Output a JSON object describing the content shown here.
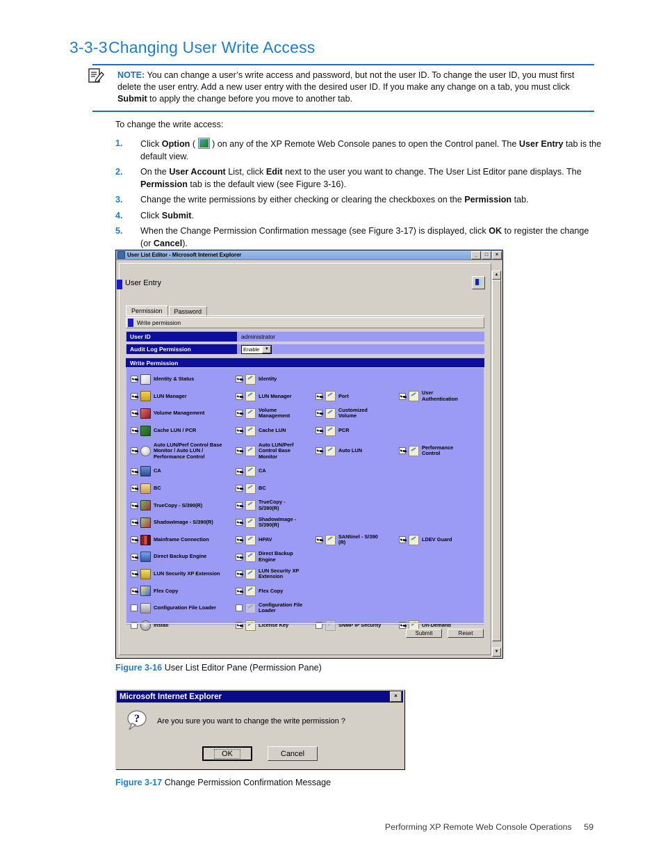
{
  "heading": {
    "number": "3-3-3",
    "title": "Changing User Write Access"
  },
  "note": {
    "label": "NOTE:",
    "text": "You can change a user’s write access and password, but not the user ID. To change the user ID, you must first delete the user entry. Add a new user entry with the desired user ID. If you make any change on a tab, you must click Submit to apply the change before you move to another tab."
  },
  "intro": "To change the write access:",
  "steps": [
    {
      "n": "1.",
      "html": "Click <b>Option</b> ( <i class=\"optglyph\" data-name=\"option-icon\"></i> ) on any of the XP Remote Web Console panes to open the Control panel. The <b>User Entry</b> tab is the default view."
    },
    {
      "n": "2.",
      "html": "On the <b>User Account</b> List, click <b>Edit</b> next to the user you want to change. The User List Editor pane displays. The <b>Permission</b> tab is the default view (see Figure 3-16)."
    },
    {
      "n": "3.",
      "html": "Change the write permissions by either checking or clearing the checkboxes on the <b>Permission</b> tab."
    },
    {
      "n": "4.",
      "html": "Click <b>Submit</b>."
    },
    {
      "n": "5.",
      "html": "When the Change Permission Confirmation message (see Figure 3-17) is displayed, click <b>OK</b> to register the change (or <b>Cancel</b>)."
    }
  ],
  "window": {
    "title": "User List Editor - Microsoft Internet Explorer",
    "min_label": "_",
    "max_label": "□",
    "close_label": "×",
    "pane_heading": "User Entry",
    "tabs": [
      {
        "label": "Permission",
        "selected": true
      },
      {
        "label": "Password",
        "selected": false
      }
    ],
    "write_permission_subtitle": "Write permission",
    "fields": [
      {
        "label": "User ID",
        "value": "administrator"
      },
      {
        "label": "Audit Log Permission",
        "value": "Enable",
        "type": "select"
      }
    ],
    "section_band": "Write Permission",
    "permission_rows": [
      {
        "c1": {
          "label": "Identity & Status",
          "checked": true,
          "icon": "i1"
        },
        "c2": {
          "label": "Identity",
          "checked": true
        },
        "c3": null,
        "c4": null
      },
      {
        "c1": {
          "label": "LUN Manager",
          "checked": true,
          "icon": "i2"
        },
        "c2": {
          "label": "LUN Manager",
          "checked": true
        },
        "c3": {
          "label": "Port",
          "checked": true
        },
        "c4": {
          "label": "User\nAuthentication",
          "checked": true
        }
      },
      {
        "c1": {
          "label": "Volume Management",
          "checked": true,
          "icon": "i3"
        },
        "c2": {
          "label": "Volume\nManagement",
          "checked": true
        },
        "c3": {
          "label": "Customized\nVolume",
          "checked": true
        },
        "c4": null
      },
      {
        "c1": {
          "label": "Cache LUN / PCR",
          "checked": true,
          "icon": "i4"
        },
        "c2": {
          "label": "Cache LUN",
          "checked": true
        },
        "c3": {
          "label": "PCR",
          "checked": true
        },
        "c4": null
      },
      {
        "c1": {
          "label": "Auto LUN/Perf Control Base\nMonitor / Auto LUN /\nPerformance Control",
          "checked": true,
          "icon": "i5"
        },
        "c2": {
          "label": "Auto LUN/Perf\nControl Base\nMonitor",
          "checked": true
        },
        "c3": {
          "label": "Auto LUN",
          "checked": true
        },
        "c4": {
          "label": "Performance\nControl",
          "checked": true
        }
      },
      {
        "c1": {
          "label": "CA",
          "checked": true,
          "icon": "i6"
        },
        "c2": {
          "label": "CA",
          "checked": true
        },
        "c3": null,
        "c4": null
      },
      {
        "c1": {
          "label": "BC",
          "checked": true,
          "icon": "i7"
        },
        "c2": {
          "label": "BC",
          "checked": true
        },
        "c3": null,
        "c4": null
      },
      {
        "c1": {
          "label": "TrueCopy - S/390(R)",
          "checked": true,
          "icon": "i8"
        },
        "c2": {
          "label": "TrueCopy -\nS/390(R)",
          "checked": true
        },
        "c3": null,
        "c4": null
      },
      {
        "c1": {
          "label": "ShadowImage - S/390(R)",
          "checked": true,
          "icon": "i9"
        },
        "c2": {
          "label": "ShadowImage -\nS/390(R)",
          "checked": true
        },
        "c3": null,
        "c4": null
      },
      {
        "c1": {
          "label": "Mainframe Connection",
          "checked": true,
          "icon": "i10"
        },
        "c2": {
          "label": "HPAV",
          "checked": true
        },
        "c3": {
          "label": "SANtinel - S/390\n(R)",
          "checked": true
        },
        "c4": {
          "label": "LDEV Guard",
          "checked": true
        }
      },
      {
        "c1": {
          "label": "Direct Backup Engine",
          "checked": true,
          "icon": "i11"
        },
        "c2": {
          "label": "Direct Backup\nEngine",
          "checked": true
        },
        "c3": null,
        "c4": null
      },
      {
        "c1": {
          "label": "LUN Security XP Extension",
          "checked": true,
          "icon": "i12"
        },
        "c2": {
          "label": "LUN Security XP\nExtension",
          "checked": true
        },
        "c3": null,
        "c4": null
      },
      {
        "c1": {
          "label": "Flex Copy",
          "checked": true,
          "icon": "i13"
        },
        "c2": {
          "label": "Flex Copy",
          "checked": true
        },
        "c3": null,
        "c4": null
      },
      {
        "c1": {
          "label": "Configuration File Loader",
          "checked": false,
          "icon": "i14"
        },
        "c2": {
          "label": "Configuration File\nLoader",
          "checked": false,
          "disabled": true
        },
        "c3": null,
        "c4": null
      },
      {
        "c1": {
          "label": "Install",
          "checked": false,
          "icon": "i15"
        },
        "c2": {
          "label": "License Key",
          "checked": true
        },
        "c3": {
          "label": "SNMP IP Security",
          "checked": false,
          "disabled": true
        },
        "c4": {
          "label": "On-Demand",
          "checked": true
        }
      }
    ],
    "submit_label": "Submit",
    "reset_label": "Reset",
    "scroll_up": "▲",
    "scroll_down": "▼"
  },
  "figure_16": {
    "label": "Figure 3-16",
    "caption": "User List Editor Pane (Permission Pane)"
  },
  "dialog": {
    "title": "Microsoft Internet Explorer",
    "close_label": "×",
    "message": "Are you sure you want to change the write permission  ?",
    "ok_label": "OK",
    "cancel_label": "Cancel"
  },
  "figure_17": {
    "label": "Figure 3-17",
    "caption": "Change Permission Confirmation Message"
  },
  "footer": {
    "text": "Performing XP Remote Web Console Operations",
    "page": "59"
  },
  "colors": {
    "accent_blue": "#1a7fd4",
    "rule_blue": "#1a6fc4",
    "header_navy": "#0d0d9e",
    "grid_lavender": "#9b9bf5",
    "chrome_gray": "#d4d0c8"
  }
}
